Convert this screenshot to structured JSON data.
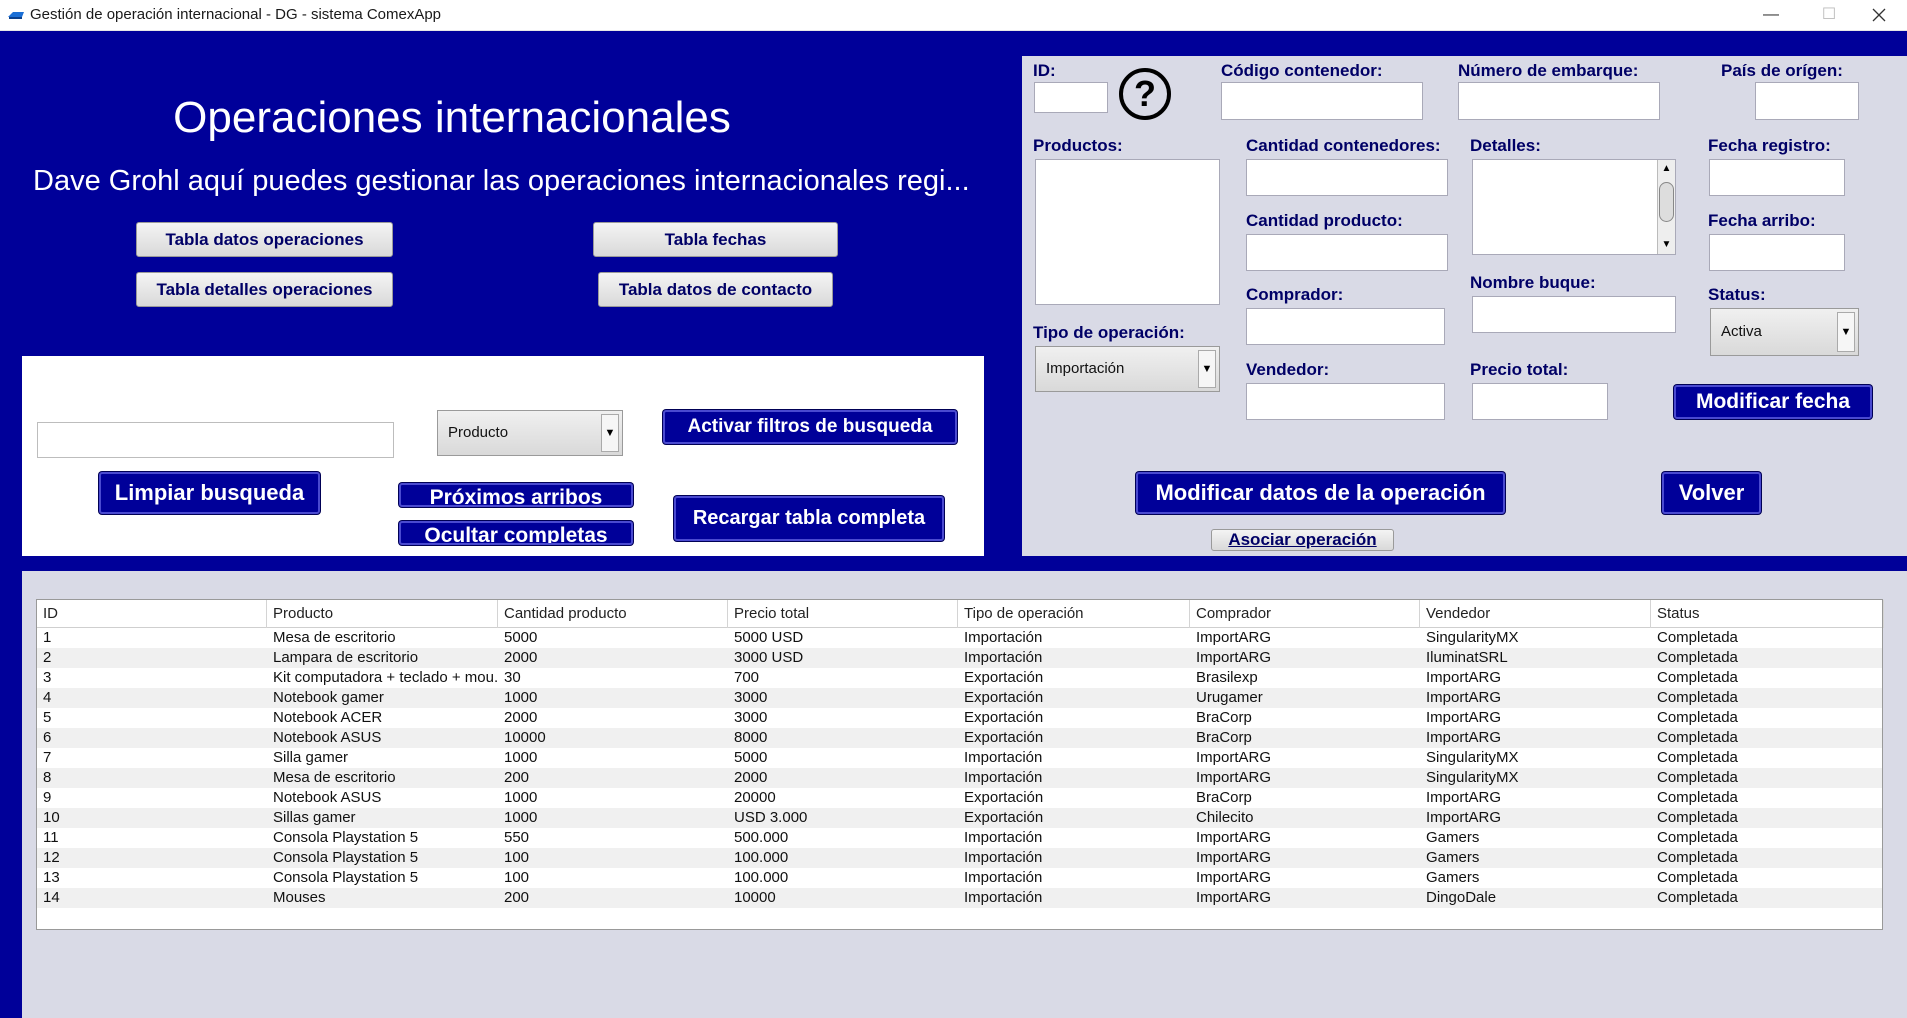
{
  "window": {
    "title": "Gestión de operación internacional - DG - sistema ComexApp",
    "minimize": "—",
    "maximize": "☐",
    "close": ""
  },
  "header": {
    "title": "Operaciones internacionales",
    "subtitle": "Dave Grohl aquí puedes gestionar las operaciones  internacionales regi..."
  },
  "nav_buttons": {
    "tabla_datos_operaciones": "Tabla datos operaciones",
    "tabla_fechas": "Tabla fechas",
    "tabla_detalles_operaciones": "Tabla detalles operaciones",
    "tabla_datos_contacto": "Tabla datos de contacto"
  },
  "search": {
    "input_value": "",
    "filter_selected": "Producto",
    "activar_filtros": "Activar filtros de busqueda",
    "limpiar": "Limpiar busqueda",
    "proximos_arribos": "Próximos arribos",
    "ocultar_completas": "Ocultar completas",
    "recargar": "Recargar tabla completa"
  },
  "form": {
    "id_label": "ID:",
    "help_icon": "?",
    "codigo_contenedor_label": "Código contenedor:",
    "numero_embarque_label": "Número de embarque:",
    "pais_origen_label": "País de orígen:",
    "productos_label": "Productos:",
    "cantidad_contenedores_label": "Cantidad contenedores:",
    "detalles_label": "Detalles:",
    "fecha_registro_label": "Fecha registro:",
    "cantidad_producto_label": "Cantidad producto:",
    "fecha_arribo_label": "Fecha arribo:",
    "nombre_buque_label": "Nombre buque:",
    "comprador_label": "Comprador:",
    "status_label": "Status:",
    "status_value": "Activa",
    "tipo_operacion_label": "Tipo de operación:",
    "tipo_operacion_value": "Importación",
    "vendedor_label": "Vendedor:",
    "precio_total_label": "Precio total:",
    "modificar_fecha": "Modificar fecha",
    "modificar_datos": "Modificar datos de la operación",
    "volver": "Volver",
    "asociar_operacion": "Asociar operación"
  },
  "table": {
    "columns": [
      "ID",
      "Producto",
      "Cantidad producto",
      "Precio total",
      "Tipo de operación",
      "Comprador",
      "Vendedor",
      "Status"
    ],
    "rows": [
      [
        "1",
        "Mesa de escritorio",
        "5000",
        "5000 USD",
        "Importación",
        "ImportARG",
        "SingularityMX",
        "Completada"
      ],
      [
        "2",
        "Lampara de escritorio",
        "2000",
        "3000 USD",
        "Importación",
        "ImportARG",
        "IluminatSRL",
        "Completada"
      ],
      [
        "3",
        "Kit computadora + teclado + mou...",
        "30",
        "700",
        "Exportación",
        "Brasilexp",
        "ImportARG",
        "Completada"
      ],
      [
        "4",
        "Notebook gamer",
        "1000",
        "3000",
        "Exportación",
        "Urugamer",
        "ImportARG",
        "Completada"
      ],
      [
        "5",
        "Notebook ACER",
        "2000",
        "3000",
        "Exportación",
        "BraCorp",
        "ImportARG",
        "Completada"
      ],
      [
        "6",
        "Notebook ASUS",
        "10000",
        "8000",
        "Exportación",
        "BraCorp",
        "ImportARG",
        "Completada"
      ],
      [
        "7",
        "Silla gamer",
        "1000",
        "5000",
        "Importación",
        "ImportARG",
        "SingularityMX",
        "Completada"
      ],
      [
        "8",
        "Mesa de escritorio",
        "200",
        "2000",
        "Importación",
        "ImportARG",
        "SingularityMX",
        "Completada"
      ],
      [
        "9",
        "Notebook ASUS",
        "1000",
        "20000",
        "Exportación",
        "BraCorp",
        "ImportARG",
        "Completada"
      ],
      [
        "10",
        "Sillas gamer",
        "1000",
        "USD 3.000",
        "Exportación",
        "Chilecito",
        "ImportARG",
        "Completada"
      ],
      [
        "11",
        "Consola Playstation 5",
        "550",
        "500.000",
        "Importación",
        "ImportARG",
        "Gamers",
        "Completada"
      ],
      [
        "12",
        "Consola Playstation 5",
        "100",
        "100.000",
        "Importación",
        "ImportARG",
        "Gamers",
        "Completada"
      ],
      [
        "13",
        "Consola Playstation 5",
        "100",
        "100.000",
        "Importación",
        "ImportARG",
        "Gamers",
        "Completada"
      ],
      [
        "14",
        "Mouses",
        "200",
        "10000",
        "Importación",
        "ImportARG",
        "DingoDale",
        "Completada"
      ]
    ]
  },
  "colors": {
    "app_background": "#000099",
    "form_panel": "#d9dae6",
    "label_text": "#000066"
  }
}
